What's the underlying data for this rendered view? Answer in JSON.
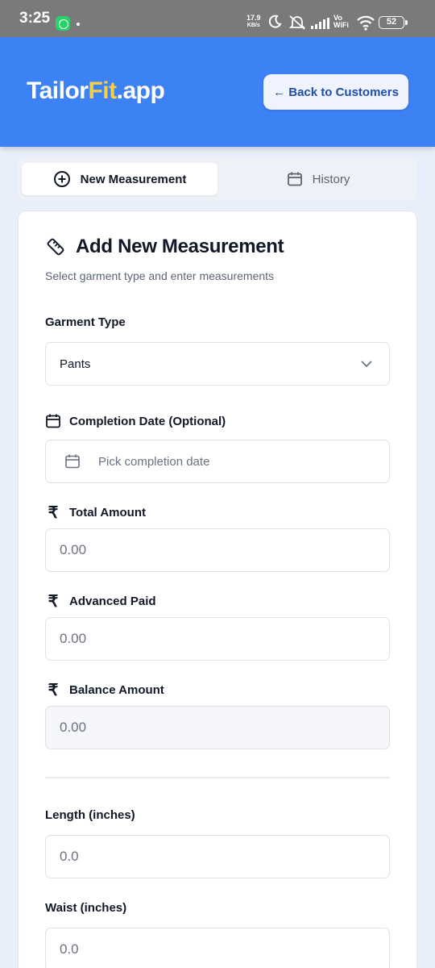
{
  "status_bar": {
    "time": "3:25",
    "speed_value": "17.9",
    "speed_unit": "KB/s",
    "vowifi_top": "Vo",
    "vowifi_bottom": "WiFi",
    "battery": "52"
  },
  "header": {
    "brand_prefix": "Tailor",
    "brand_accent": "Fit",
    "brand_suffix": ".app",
    "back_button_label": "← Back to Customers",
    "colors": {
      "background": "#3d82f4",
      "accent": "#f7d043"
    }
  },
  "tabs": [
    {
      "label": "New Measurement",
      "icon": "plus-circle-icon",
      "active": true
    },
    {
      "label": "History",
      "icon": "calendar-icon",
      "active": false
    }
  ],
  "card": {
    "title": "Add New Measurement",
    "subtitle": "Select garment type and enter measurements",
    "title_icon": "ruler-icon"
  },
  "form": {
    "garment_type_label": "Garment Type",
    "garment_type_value": "Pants",
    "completion_date_label": "Completion Date (Optional)",
    "completion_date_placeholder": "Pick completion date",
    "total_amount_label": "Total Amount",
    "total_amount_value": "0.00",
    "advanced_paid_label": "Advanced Paid",
    "advanced_paid_value": "0.00",
    "balance_amount_label": "Balance Amount",
    "balance_amount_value": "0.00",
    "length_label": "Length (inches)",
    "length_value": "0.0",
    "waist_label": "Waist (inches)",
    "waist_value": "0.0"
  }
}
